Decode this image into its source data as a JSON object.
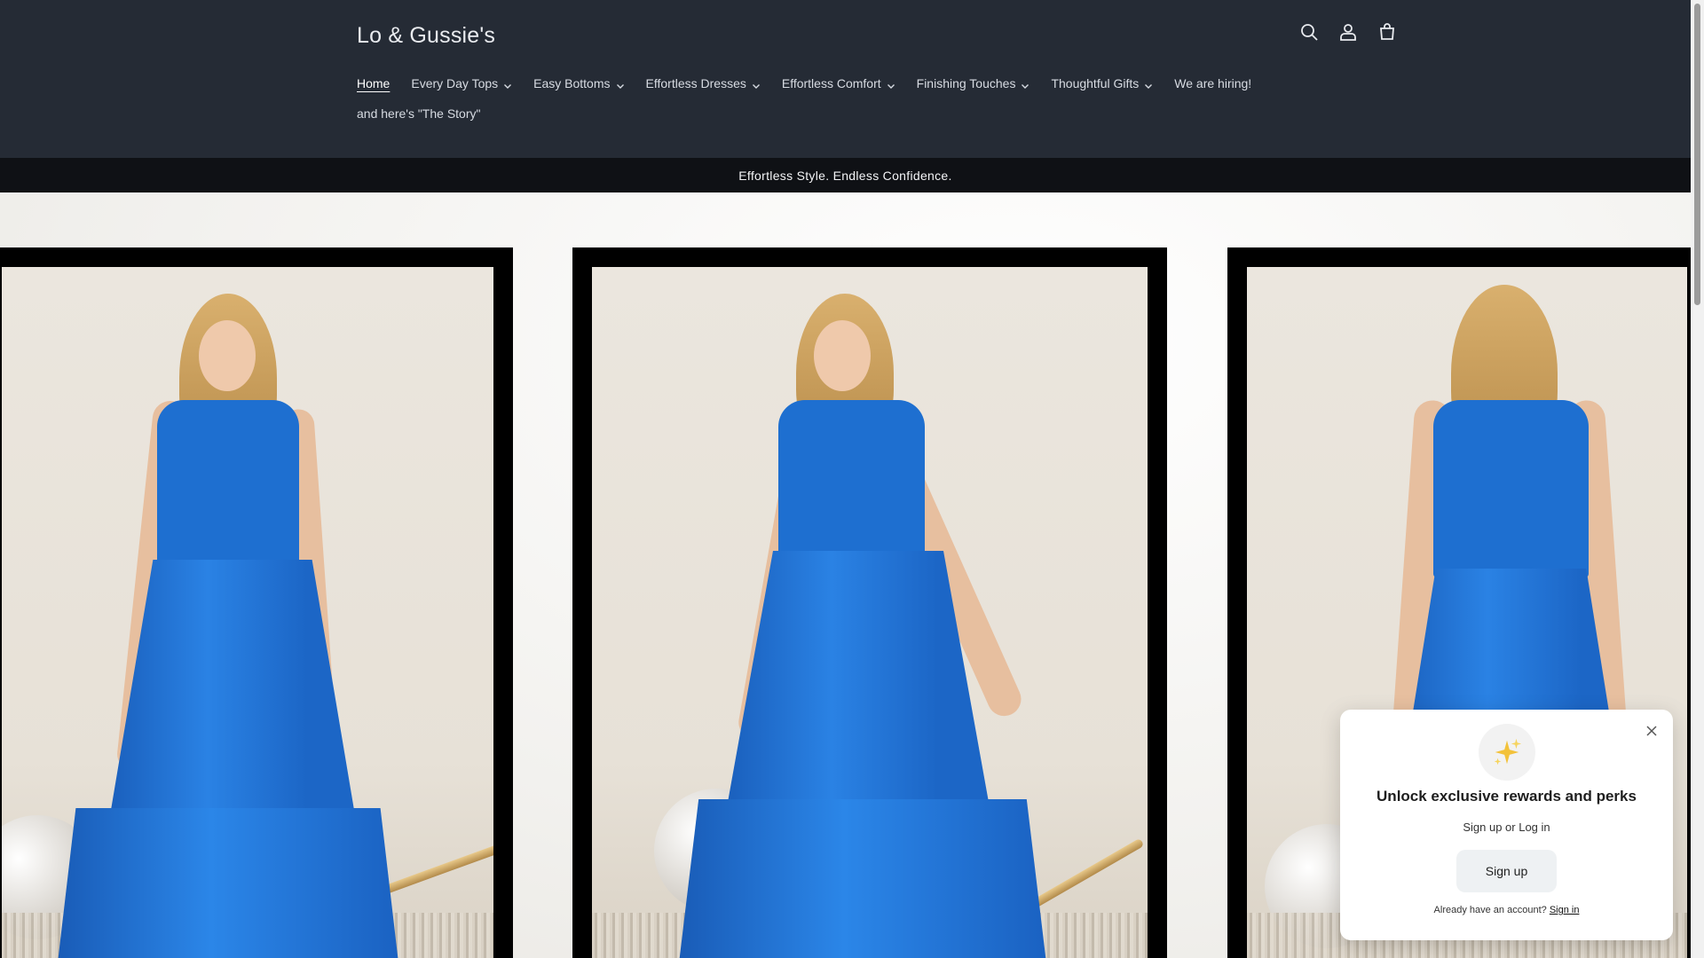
{
  "header": {
    "brand": "Lo & Gussie's",
    "icons": [
      "search-icon",
      "account-icon",
      "cart-icon"
    ]
  },
  "nav": {
    "items": [
      {
        "label": "Home",
        "active": true,
        "has_dropdown": false
      },
      {
        "label": "Every Day Tops",
        "has_dropdown": true
      },
      {
        "label": "Easy Bottoms",
        "has_dropdown": true
      },
      {
        "label": "Effortless Dresses",
        "has_dropdown": true
      },
      {
        "label": "Effortless Comfort",
        "has_dropdown": true
      },
      {
        "label": "Finishing Touches",
        "has_dropdown": true
      },
      {
        "label": "Thoughtful Gifts",
        "has_dropdown": true
      },
      {
        "label": "We are hiring!",
        "has_dropdown": false
      },
      {
        "label": "and here's \"The Story\"",
        "has_dropdown": false
      }
    ]
  },
  "announcement": {
    "text": "Effortless Style. Endless Confidence."
  },
  "popup": {
    "title": "Unlock exclusive rewards and perks",
    "subtitle": "Sign up or Log in",
    "button_label": "Sign up",
    "footer_text": "Already have an account?",
    "footer_link": "Sign in",
    "icon": "sparkles-icon"
  },
  "colors": {
    "header_bg": "#252b35",
    "announcement_bg": "#0f1115",
    "dress_blue": "#1e6fd0",
    "popup_bg": "#ffffff"
  }
}
